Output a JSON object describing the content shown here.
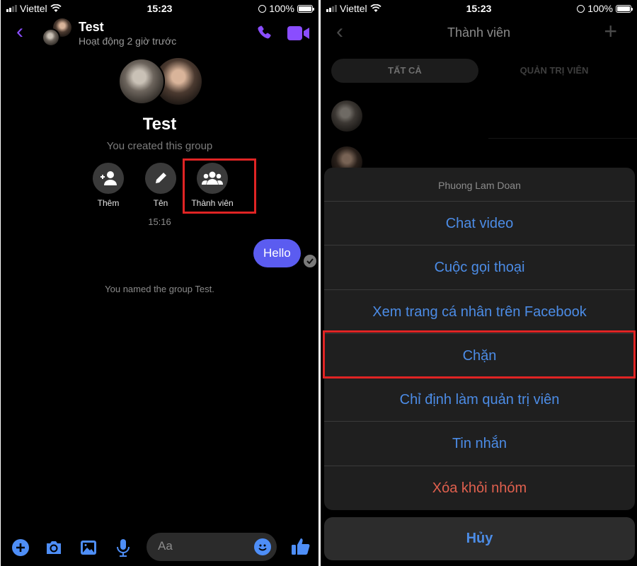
{
  "status_bar": {
    "carrier": "Viettel",
    "time": "15:23",
    "battery": "100%"
  },
  "left": {
    "header": {
      "title": "Test",
      "subtitle": "Hoạt động 2 giờ trước",
      "icons": [
        "back-icon",
        "phone-icon",
        "video-call-icon"
      ]
    },
    "group": {
      "name": "Test",
      "created_text": "You created this group"
    },
    "actions": [
      {
        "label": "Thêm",
        "icon": "add-person-icon"
      },
      {
        "label": "Tên",
        "icon": "pencil-icon"
      },
      {
        "label": "Thành viên",
        "icon": "group-members-icon",
        "highlighted": true
      }
    ],
    "timestamp": "15:16",
    "messages": [
      {
        "text": "Hello",
        "from": "me",
        "status": "seen"
      }
    ],
    "system_message": "You named the group Test.",
    "composer": {
      "placeholder": "Aa",
      "icons": [
        "plus-icon",
        "camera-icon",
        "image-icon",
        "microphone-icon",
        "emoji-icon",
        "thumbs-up-icon"
      ]
    },
    "accent_color": "#8a4dff",
    "bubble_color": "#5b5cf0"
  },
  "right": {
    "header": {
      "title": "Thành viên",
      "icons": [
        "back-icon",
        "plus-icon"
      ]
    },
    "tabs": [
      {
        "label": "TẤT CẢ",
        "active": true
      },
      {
        "label": "QUẢN TRỊ VIÊN",
        "active": false
      }
    ],
    "action_sheet": {
      "title": "Phuong Lam Doan",
      "items": [
        {
          "label": "Chat video"
        },
        {
          "label": "Cuộc gọi thoại"
        },
        {
          "label": "Xem trang cá nhân trên Facebook"
        },
        {
          "label": "Chặn",
          "highlighted": true
        },
        {
          "label": "Chỉ định làm quản trị viên"
        },
        {
          "label": "Tin nhắn"
        },
        {
          "label": "Xóa khỏi nhóm",
          "destructive": true
        }
      ],
      "cancel_label": "Hủy"
    },
    "link_color": "#4c8ce6",
    "destructive_color": "#e0604e",
    "highlight_color": "#e02424"
  }
}
